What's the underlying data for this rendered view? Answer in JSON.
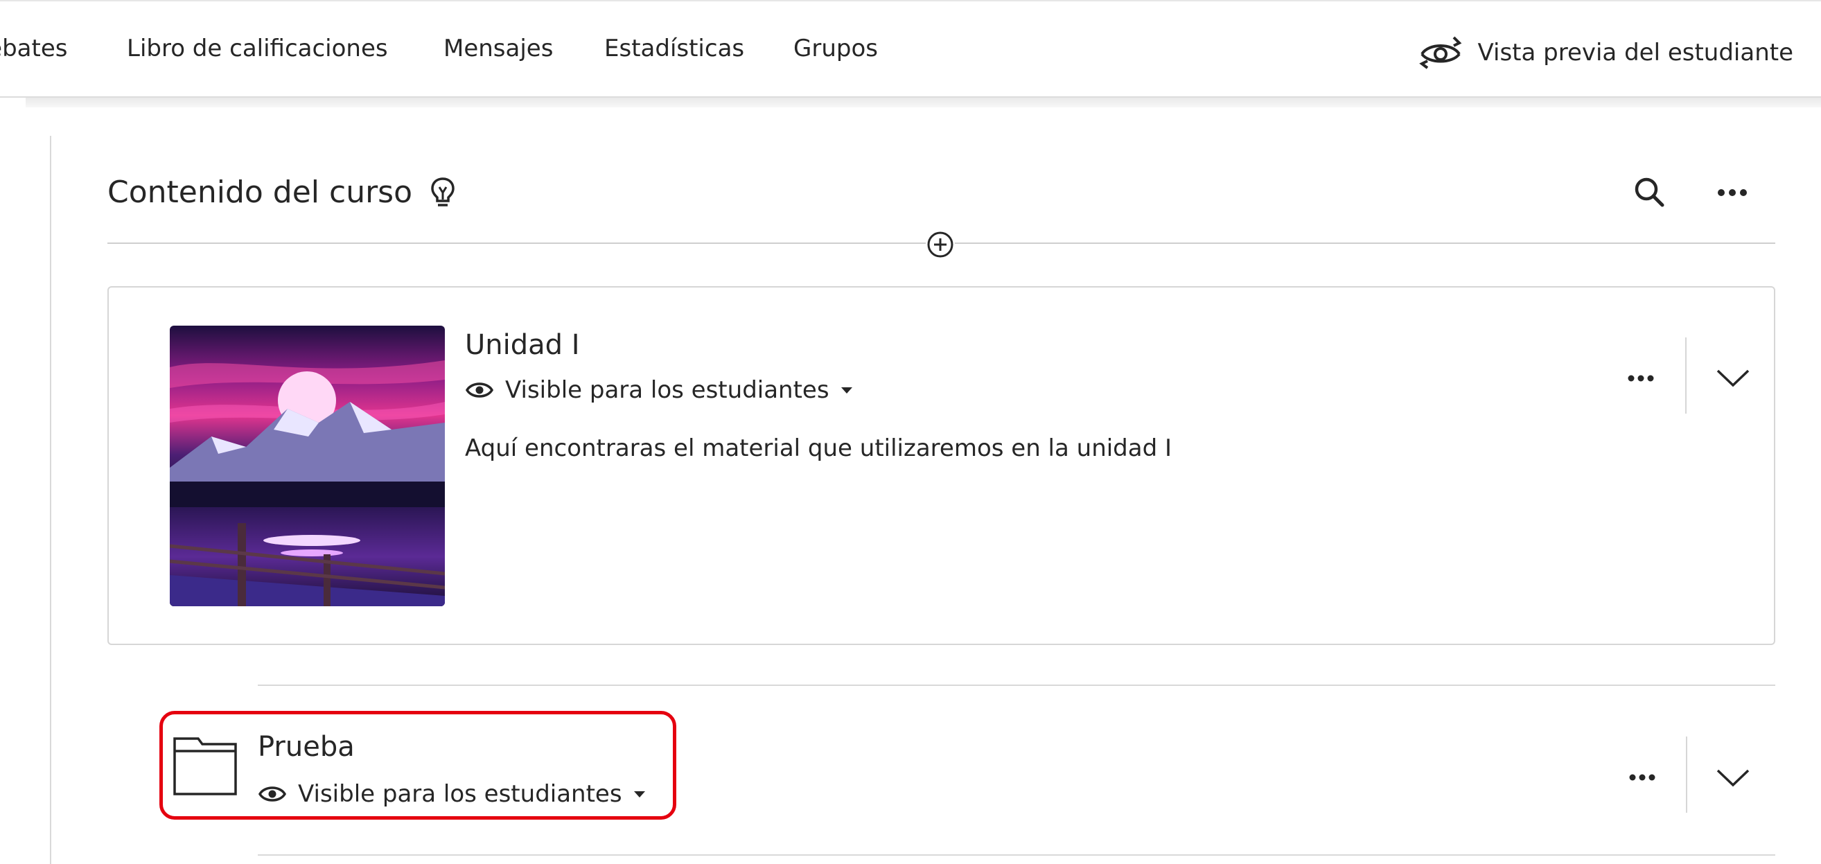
{
  "nav": {
    "tabs": [
      {
        "label": "Debates"
      },
      {
        "label": "Libro de calificaciones"
      },
      {
        "label": "Mensajes"
      },
      {
        "label": "Estadísticas"
      },
      {
        "label": "Grupos"
      }
    ],
    "student_preview_label": "Vista previa del estudiante",
    "student_preview_icon": "eye-rotate-icon"
  },
  "content": {
    "title": "Contenido del curso",
    "title_icon": "lightbulb-icon",
    "search_icon": "search-icon",
    "more_icon": "more-horizontal-icon",
    "add_icon": "plus-circle-icon"
  },
  "items": [
    {
      "title": "Unidad I",
      "visibility": "Visible para los estudiantes",
      "description": "Aquí encontraras el material que utilizaremos en la unidad I",
      "thumbnail": "mountain-moon-landscape-image"
    },
    {
      "title": "Prueba",
      "visibility": "Visible para los estudiantes",
      "icon": "folder-icon",
      "highlighted": true
    }
  ],
  "colors": {
    "highlight": "#e5000f",
    "text": "#262626",
    "divider": "#d6d6d6"
  }
}
